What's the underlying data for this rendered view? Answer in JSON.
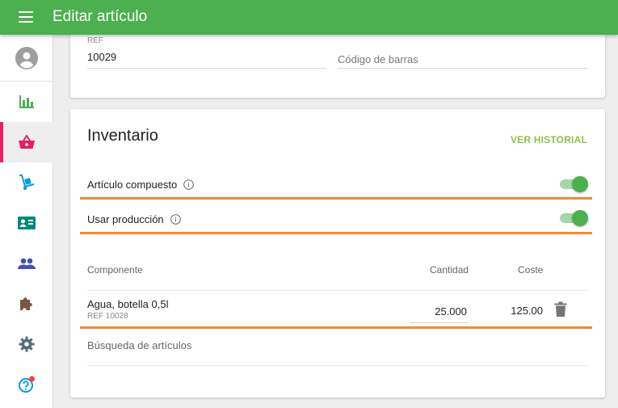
{
  "appbar": {
    "title": "Editar artículo",
    "color": "#4caf50"
  },
  "sidebar": {
    "items": [
      {
        "name": "account-icon",
        "color": "#9e9e9e"
      },
      {
        "name": "bar-chart-icon",
        "color": "#4caf50"
      },
      {
        "name": "basket-icon",
        "color": "#e91e63",
        "active": true
      },
      {
        "name": "hand-truck-icon",
        "color": "#039be5"
      },
      {
        "name": "contact-card-icon",
        "color": "#00897b"
      },
      {
        "name": "people-icon",
        "color": "#3f51b5"
      },
      {
        "name": "puzzle-icon",
        "color": "#795548"
      },
      {
        "name": "gear-icon",
        "color": "#546e7a"
      },
      {
        "name": "help-icon",
        "color": "#039be5",
        "badge_color": "#f44336"
      }
    ]
  },
  "details": {
    "ref_label": "REF",
    "ref_value": "10029",
    "barcode_placeholder": "Código de barras"
  },
  "inventory": {
    "title": "Inventario",
    "history_button": "VER HISTORIAL",
    "composite_label": "Artículo compuesto",
    "composite_on": true,
    "production_label": "Usar producción",
    "production_on": true,
    "columns": {
      "component": "Componente",
      "quantity": "Cantidad",
      "cost": "Coste"
    },
    "components": [
      {
        "name": "Agua, botella 0,5l",
        "ref": "REF 10028",
        "quantity": "25.000",
        "cost": "125.00"
      }
    ],
    "search_placeholder": "Búsqueda de artículos"
  },
  "accent_colors": {
    "orange_underline": "#f08a30",
    "link": "#8bc34a"
  }
}
